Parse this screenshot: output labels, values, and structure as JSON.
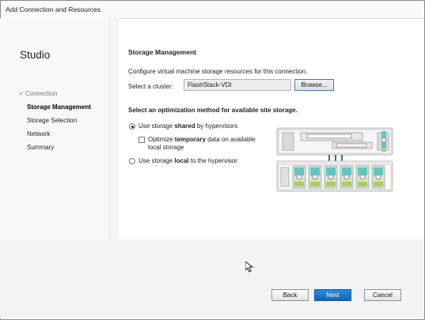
{
  "window": {
    "title": "Add Connection and Resources"
  },
  "sidebar": {
    "app_name": "Studio",
    "items": [
      {
        "label": "Connection",
        "state": "done"
      },
      {
        "label": "Storage Management",
        "state": "active"
      },
      {
        "label": "Storage Selection",
        "state": "pending"
      },
      {
        "label": "Network",
        "state": "pending"
      },
      {
        "label": "Summary",
        "state": "pending"
      }
    ]
  },
  "main": {
    "heading": "Storage Management",
    "description": "Configure virtual machine storage resources for this connection.",
    "cluster": {
      "label": "Select a cluster:",
      "value": "FlashStack-VDI",
      "browse_label": "Browse..."
    },
    "optimization": {
      "heading": "Select an optimization method for available site storage.",
      "shared": {
        "pre": "Use storage ",
        "bold": "shared",
        "post": " by hypervisors",
        "selected": true
      },
      "temporary": {
        "pre": "Optimize ",
        "bold": "temporary",
        "post": " data on available",
        "line2": "local storage",
        "checked": false
      },
      "local": {
        "pre": "Use storage ",
        "bold": "local",
        "post": " to the hypervisor",
        "selected": false
      }
    }
  },
  "footer": {
    "back_label": "Back",
    "next_label": "Next",
    "cancel_label": "Cancel"
  },
  "colors": {
    "accent": "#1a73c4",
    "sidebar_bg": "#f4f4f4",
    "storage_teal": "#5ec7c0",
    "storage_green": "#a6cf4f"
  }
}
